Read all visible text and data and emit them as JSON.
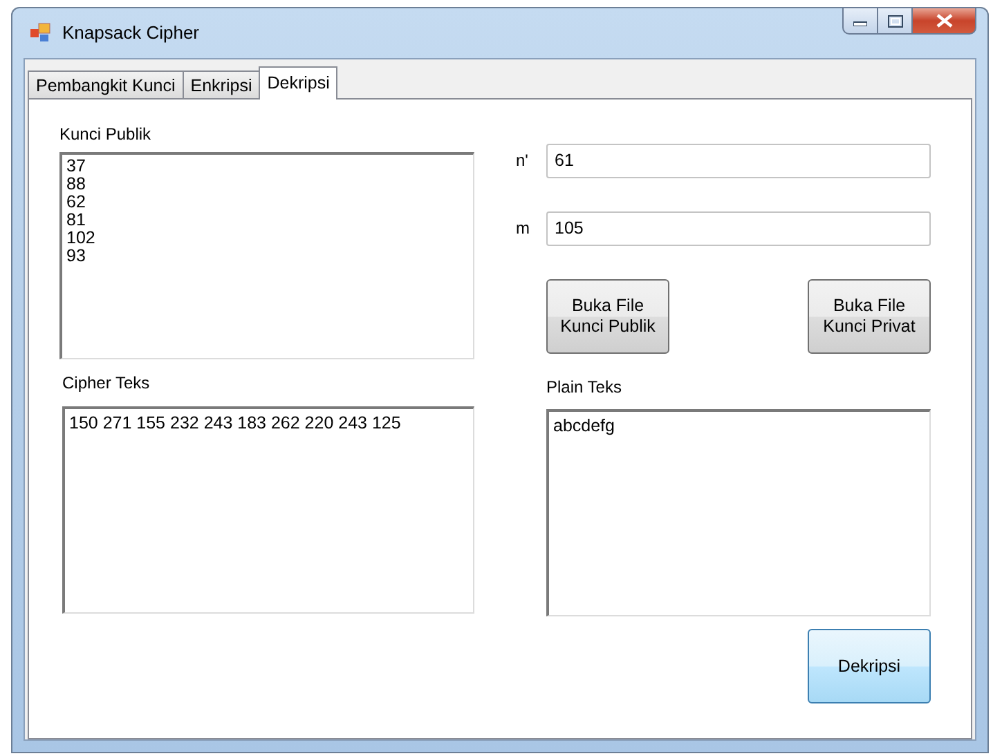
{
  "window": {
    "title": "Knapsack Cipher"
  },
  "tabs": [
    {
      "label": "Pembangkit Kunci",
      "selected": false
    },
    {
      "label": "Enkripsi",
      "selected": false
    },
    {
      "label": "Dekripsi",
      "selected": true
    }
  ],
  "public_key": {
    "label": "Kunci Publik",
    "lines": [
      "37",
      "88",
      "62",
      "81",
      "102",
      "93"
    ]
  },
  "fields": [
    {
      "label": "n'",
      "value": "61"
    },
    {
      "label": "m",
      "value": "105"
    }
  ],
  "file_buttons": [
    "Buka File Kunci Publik",
    "Buka File Kunci Privat"
  ],
  "cipher_text": {
    "label": "Cipher Teks",
    "value": "150 271 155 232 243 183 262 220 243 125"
  },
  "plain_text": {
    "label": "Plain Teks",
    "value": "abcdefg"
  },
  "action_button": "Dekripsi"
}
